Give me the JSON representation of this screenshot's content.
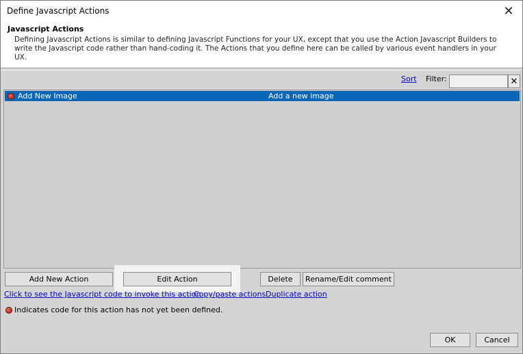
{
  "window": {
    "title": "Define Javascript Actions"
  },
  "header": {
    "title": "Javascript Actions",
    "description": "Defining Javascript Actions is similar to defining Javascript Functions for your UX, except that you use the Action Javascript Builders to write the Javascript code rather than hand-coding it. The Actions that you define here can be called by various event handlers in your UX."
  },
  "toolbar": {
    "sort_label": "Sort",
    "filter_label": "Filter:",
    "filter_value": ""
  },
  "actions_list": {
    "items": [
      {
        "name": "Add New Image",
        "comment": "Add a new image",
        "selected": true,
        "defined": false
      }
    ]
  },
  "buttons": {
    "add_new_action": "Add New Action",
    "edit_action": "Edit Action",
    "delete": "Delete",
    "rename_edit_comment": "Rename/Edit comment",
    "ok": "OK",
    "cancel": "Cancel"
  },
  "links": {
    "see_code": "Click to see the Javascript code to invoke this action",
    "copy_paste": "Copy/paste actions",
    "duplicate": "Duplicate action"
  },
  "legend": {
    "text": "Indicates code for this action has not yet been defined."
  },
  "colors": {
    "selection": "#0a66b7",
    "link": "#0000cc",
    "undefined_dot": "#b0251a"
  },
  "icons": {
    "close": "close-icon",
    "filter_clear": "clear-x-icon",
    "undefined_marker": "red-dot-icon"
  }
}
